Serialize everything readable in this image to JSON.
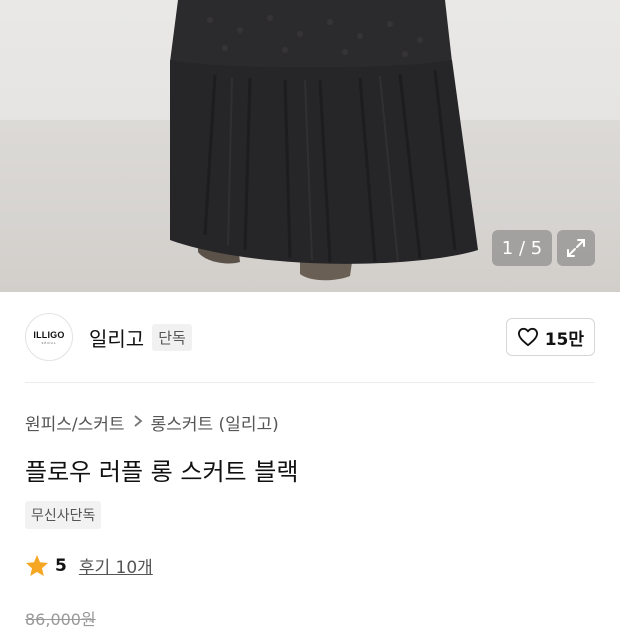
{
  "gallery": {
    "counter": "1 / 5",
    "expand_icon": "expand-icon"
  },
  "brand": {
    "logo_text": "ILLIGO",
    "logo_subtext": "SEOUL",
    "name": "일리고",
    "badge": "단독",
    "like_icon": "heart-outline-icon",
    "like_count": "15만"
  },
  "breadcrumb": {
    "category": "원피스/스커트",
    "separator_icon": "chevron-right-icon",
    "subcategory": "롱스커트 (일리고)"
  },
  "product": {
    "title": "플로우 러플 롱 스커트 블랙",
    "tag": "무신사단독",
    "rating_icon": "star-icon",
    "rating_score": "5",
    "review_link": "후기 10개",
    "original_price": "86,000원"
  },
  "colors": {
    "star": "#f5a623",
    "skirt": "#2a2a2c",
    "background": "#e6e5e3"
  }
}
